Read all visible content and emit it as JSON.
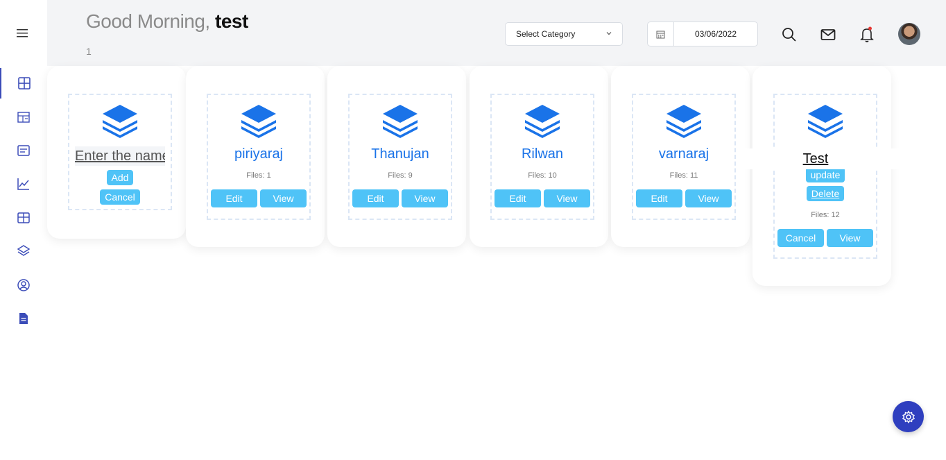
{
  "header": {
    "greeting_prefix": "Good Morning,",
    "username": "test",
    "subline": "1",
    "category_select": "Select Category",
    "date": "03/06/2022"
  },
  "cards": [
    {
      "name": "piriyaraj",
      "files": "Files: 1"
    },
    {
      "name": "Thanujan",
      "files": "Files: 9"
    },
    {
      "name": "Rilwan",
      "files": "Files: 10"
    },
    {
      "name": "varnaraj",
      "files": "Files: 11"
    }
  ],
  "new_card": {
    "placeholder": "Enter the name",
    "add_label": "Add",
    "cancel_label": "Cancel"
  },
  "editing_card": {
    "name": "Test",
    "update_label": "update",
    "delete_label": "Delete",
    "files": "Files: 12",
    "cancel_label": "Cancel",
    "view_label": "View"
  },
  "labels": {
    "edit": "Edit",
    "view": "View"
  },
  "sidebar": {
    "icons": [
      "dashboard-icon",
      "layout-icon",
      "list-icon",
      "chart-icon",
      "table-icon",
      "layers-icon",
      "user-icon",
      "document-icon"
    ]
  },
  "colors": {
    "accent": "#4fc3f7",
    "primary": "#1a73e8",
    "nav": "#3b4cb8",
    "fab": "#2f3fbf"
  }
}
